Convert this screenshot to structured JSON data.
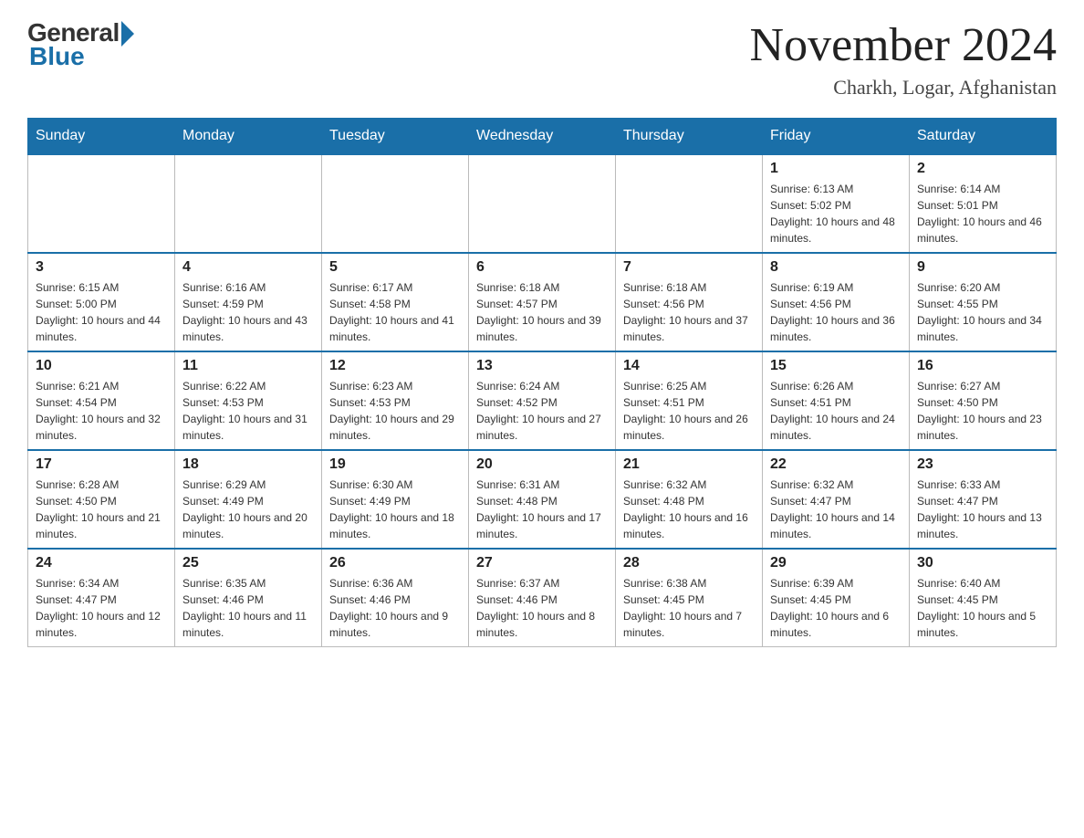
{
  "header": {
    "logo": {
      "general": "General",
      "blue": "Blue"
    },
    "month": "November 2024",
    "location": "Charkh, Logar, Afghanistan"
  },
  "days_of_week": [
    "Sunday",
    "Monday",
    "Tuesday",
    "Wednesday",
    "Thursday",
    "Friday",
    "Saturday"
  ],
  "weeks": [
    {
      "days": [
        {
          "date": "",
          "info": ""
        },
        {
          "date": "",
          "info": ""
        },
        {
          "date": "",
          "info": ""
        },
        {
          "date": "",
          "info": ""
        },
        {
          "date": "",
          "info": ""
        },
        {
          "date": "1",
          "info": "Sunrise: 6:13 AM\nSunset: 5:02 PM\nDaylight: 10 hours and 48 minutes."
        },
        {
          "date": "2",
          "info": "Sunrise: 6:14 AM\nSunset: 5:01 PM\nDaylight: 10 hours and 46 minutes."
        }
      ]
    },
    {
      "days": [
        {
          "date": "3",
          "info": "Sunrise: 6:15 AM\nSunset: 5:00 PM\nDaylight: 10 hours and 44 minutes."
        },
        {
          "date": "4",
          "info": "Sunrise: 6:16 AM\nSunset: 4:59 PM\nDaylight: 10 hours and 43 minutes."
        },
        {
          "date": "5",
          "info": "Sunrise: 6:17 AM\nSunset: 4:58 PM\nDaylight: 10 hours and 41 minutes."
        },
        {
          "date": "6",
          "info": "Sunrise: 6:18 AM\nSunset: 4:57 PM\nDaylight: 10 hours and 39 minutes."
        },
        {
          "date": "7",
          "info": "Sunrise: 6:18 AM\nSunset: 4:56 PM\nDaylight: 10 hours and 37 minutes."
        },
        {
          "date": "8",
          "info": "Sunrise: 6:19 AM\nSunset: 4:56 PM\nDaylight: 10 hours and 36 minutes."
        },
        {
          "date": "9",
          "info": "Sunrise: 6:20 AM\nSunset: 4:55 PM\nDaylight: 10 hours and 34 minutes."
        }
      ]
    },
    {
      "days": [
        {
          "date": "10",
          "info": "Sunrise: 6:21 AM\nSunset: 4:54 PM\nDaylight: 10 hours and 32 minutes."
        },
        {
          "date": "11",
          "info": "Sunrise: 6:22 AM\nSunset: 4:53 PM\nDaylight: 10 hours and 31 minutes."
        },
        {
          "date": "12",
          "info": "Sunrise: 6:23 AM\nSunset: 4:53 PM\nDaylight: 10 hours and 29 minutes."
        },
        {
          "date": "13",
          "info": "Sunrise: 6:24 AM\nSunset: 4:52 PM\nDaylight: 10 hours and 27 minutes."
        },
        {
          "date": "14",
          "info": "Sunrise: 6:25 AM\nSunset: 4:51 PM\nDaylight: 10 hours and 26 minutes."
        },
        {
          "date": "15",
          "info": "Sunrise: 6:26 AM\nSunset: 4:51 PM\nDaylight: 10 hours and 24 minutes."
        },
        {
          "date": "16",
          "info": "Sunrise: 6:27 AM\nSunset: 4:50 PM\nDaylight: 10 hours and 23 minutes."
        }
      ]
    },
    {
      "days": [
        {
          "date": "17",
          "info": "Sunrise: 6:28 AM\nSunset: 4:50 PM\nDaylight: 10 hours and 21 minutes."
        },
        {
          "date": "18",
          "info": "Sunrise: 6:29 AM\nSunset: 4:49 PM\nDaylight: 10 hours and 20 minutes."
        },
        {
          "date": "19",
          "info": "Sunrise: 6:30 AM\nSunset: 4:49 PM\nDaylight: 10 hours and 18 minutes."
        },
        {
          "date": "20",
          "info": "Sunrise: 6:31 AM\nSunset: 4:48 PM\nDaylight: 10 hours and 17 minutes."
        },
        {
          "date": "21",
          "info": "Sunrise: 6:32 AM\nSunset: 4:48 PM\nDaylight: 10 hours and 16 minutes."
        },
        {
          "date": "22",
          "info": "Sunrise: 6:32 AM\nSunset: 4:47 PM\nDaylight: 10 hours and 14 minutes."
        },
        {
          "date": "23",
          "info": "Sunrise: 6:33 AM\nSunset: 4:47 PM\nDaylight: 10 hours and 13 minutes."
        }
      ]
    },
    {
      "days": [
        {
          "date": "24",
          "info": "Sunrise: 6:34 AM\nSunset: 4:47 PM\nDaylight: 10 hours and 12 minutes."
        },
        {
          "date": "25",
          "info": "Sunrise: 6:35 AM\nSunset: 4:46 PM\nDaylight: 10 hours and 11 minutes."
        },
        {
          "date": "26",
          "info": "Sunrise: 6:36 AM\nSunset: 4:46 PM\nDaylight: 10 hours and 9 minutes."
        },
        {
          "date": "27",
          "info": "Sunrise: 6:37 AM\nSunset: 4:46 PM\nDaylight: 10 hours and 8 minutes."
        },
        {
          "date": "28",
          "info": "Sunrise: 6:38 AM\nSunset: 4:45 PM\nDaylight: 10 hours and 7 minutes."
        },
        {
          "date": "29",
          "info": "Sunrise: 6:39 AM\nSunset: 4:45 PM\nDaylight: 10 hours and 6 minutes."
        },
        {
          "date": "30",
          "info": "Sunrise: 6:40 AM\nSunset: 4:45 PM\nDaylight: 10 hours and 5 minutes."
        }
      ]
    }
  ],
  "colors": {
    "header_bg": "#1a6fa8",
    "header_text": "#ffffff",
    "border": "#bbbbbb",
    "day_number": "#222222",
    "day_info": "#333333"
  }
}
